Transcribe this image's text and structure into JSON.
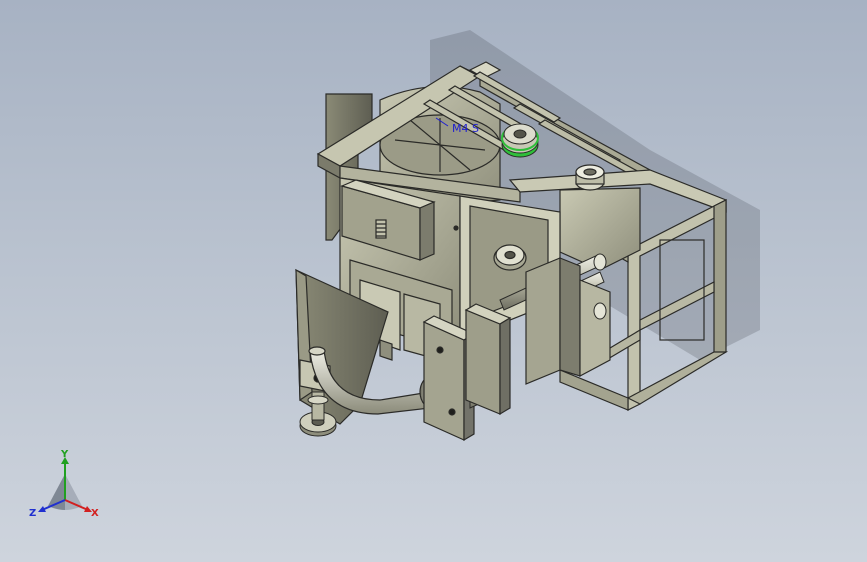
{
  "viewport": {
    "background_top": "#a7b2c3",
    "background_bottom": "#ced4dd"
  },
  "annotation": {
    "text": "M4 S",
    "color": "#2020d0"
  },
  "triad": {
    "x_label": "X",
    "y_label": "Y",
    "z_label": "Z",
    "x_color": "#d22020",
    "y_color": "#20a020",
    "z_color": "#2030d0"
  },
  "model": {
    "body_color": "#b9b9a2",
    "edge_color": "#2b2b28",
    "accent_color": "#2fbf3a"
  }
}
